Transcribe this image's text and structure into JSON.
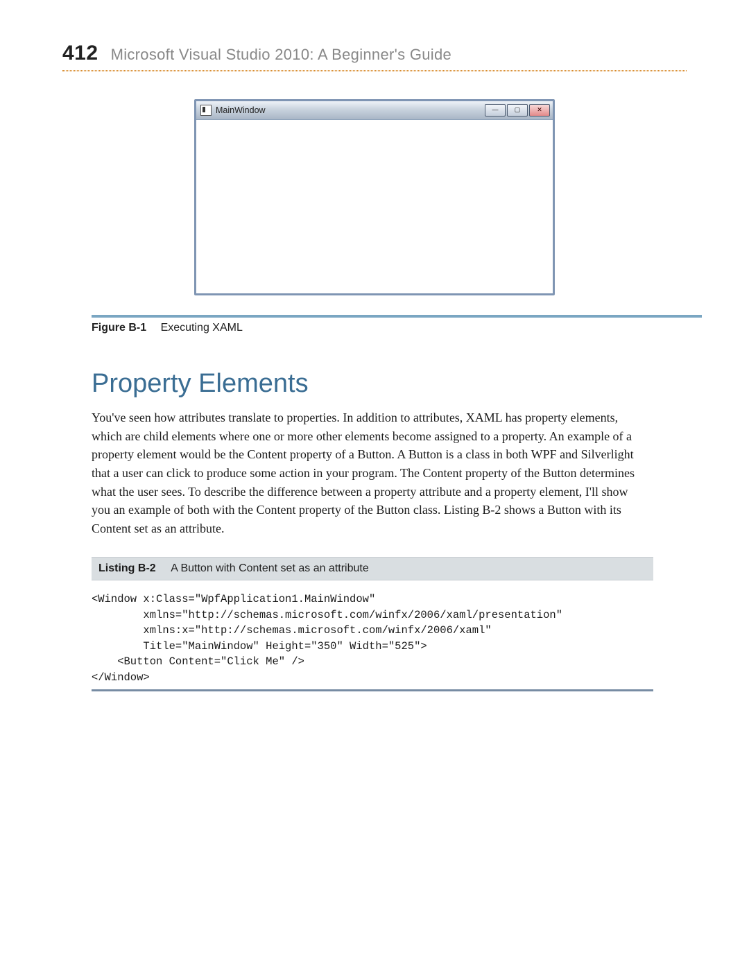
{
  "header": {
    "page_number": "412",
    "book_title": "Microsoft Visual Studio 2010: A Beginner's Guide"
  },
  "window": {
    "title": "MainWindow",
    "buttons": {
      "minimize": "—",
      "maximize": "▢",
      "close": "✕"
    }
  },
  "figure": {
    "label": "Figure B-1",
    "caption": "Executing XAML"
  },
  "section": {
    "heading": "Property Elements",
    "body": "You've seen how attributes translate to properties. In addition to attributes, XAML has property elements, which are child elements where one or more other elements become assigned to a property. An example of a property element would be the Content property of a Button. A Button is a class in both WPF and Silverlight that a user can click to produce some action in your program. The Content property of the Button determines what the user sees. To describe the difference between a property attribute and a property element, I'll show you an example of both with the Content property of the Button class. Listing B-2 shows a Button with its Content set as an attribute."
  },
  "listing": {
    "label": "Listing B-2",
    "caption": "A Button with Content set as an attribute",
    "code": "<Window x:Class=\"WpfApplication1.MainWindow\"\n        xmlns=\"http://schemas.microsoft.com/winfx/2006/xaml/presentation\"\n        xmlns:x=\"http://schemas.microsoft.com/winfx/2006/xaml\"\n        Title=\"MainWindow\" Height=\"350\" Width=\"525\">\n    <Button Content=\"Click Me\" />\n</Window>"
  }
}
